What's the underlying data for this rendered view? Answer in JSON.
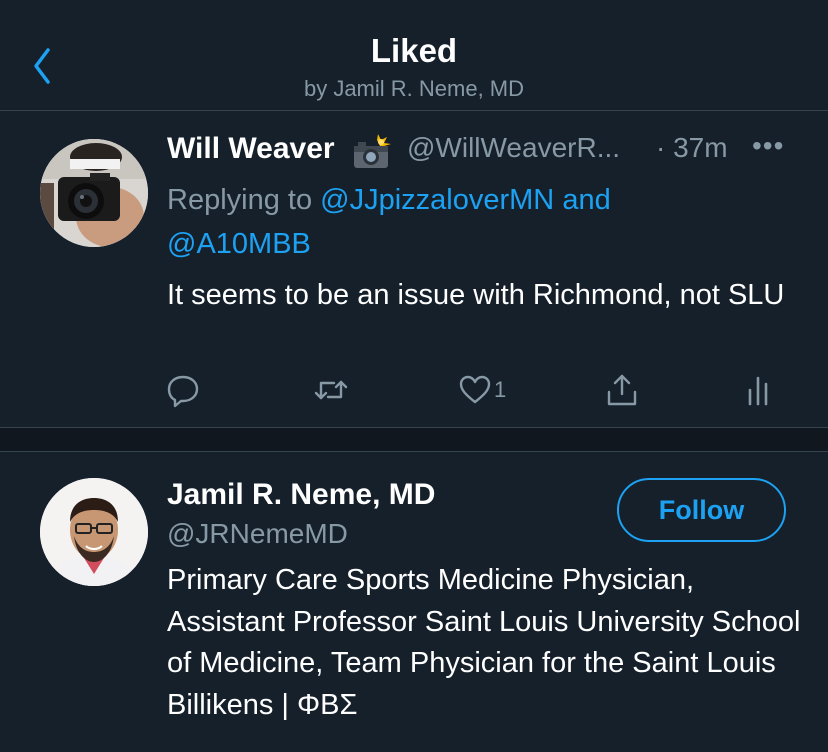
{
  "header": {
    "title": "Liked",
    "subtitle": "by Jamil R. Neme, MD"
  },
  "tweet": {
    "author_name": "Will Weaver",
    "author_emoji": "📸",
    "handle": "@WillWeaverR...",
    "time": "· 37m",
    "more": "•••",
    "replying_prefix": "Replying to",
    "replying_user1": "@JJpizzaloverMN",
    "replying_and": "and",
    "replying_user2": "@A10MBB",
    "text": "It seems to be an issue with Richmond, not SLU",
    "like_count": "1"
  },
  "user_card": {
    "name": "Jamil R. Neme, MD",
    "handle": "@JRNemeMD",
    "follow_label": "Follow",
    "bio": "Primary Care Sports Medicine Physician, Assistant Professor Saint Louis University School of Medicine, Team Physician for the Saint Louis Billikens | ΦΒΣ"
  },
  "colors": {
    "background": "#15202b",
    "accent": "#1da1f2",
    "secondary_text": "#8899a6",
    "divider": "#38444d"
  },
  "icons": {
    "back": "chevron-left-icon",
    "reply": "comment-icon",
    "retweet": "retweet-icon",
    "like": "heart-icon",
    "share": "share-icon",
    "analytics": "analytics-icon"
  }
}
